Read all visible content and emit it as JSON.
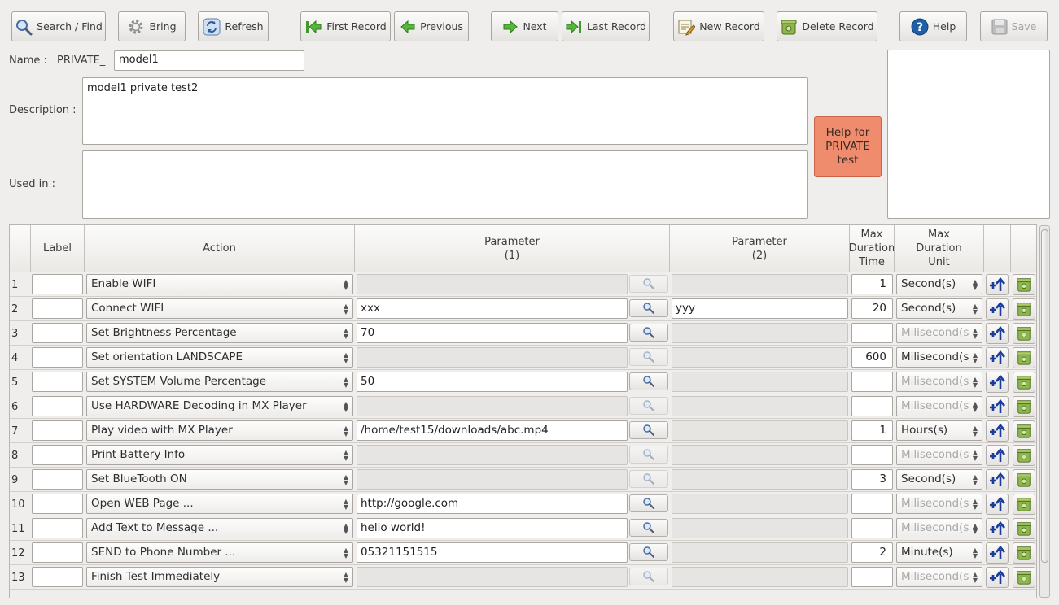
{
  "toolbar": {
    "search": "Search / Find",
    "bring": "Bring",
    "refresh": "Refresh",
    "first": "First Record",
    "previous": "Previous",
    "next": "Next",
    "last": "Last Record",
    "new": "New Record",
    "delete": "Delete Record",
    "help": "Help",
    "save": "Save"
  },
  "form": {
    "name_label": "Name :",
    "name_prefix": "PRIVATE_",
    "name_value": "model1",
    "description_label": "Description :",
    "description_value": "model1 private test2",
    "used_in_label": "Used in :",
    "used_in_value": "",
    "help_button": "Help for PRIVATE test"
  },
  "grid": {
    "headers": {
      "label": "Label",
      "action": "Action",
      "param1": "Parameter\n(1)",
      "param2": "Parameter\n(2)",
      "max_time": "Max\nDuration\nTime",
      "max_unit": "Max\nDuration\nUnit"
    },
    "rows": [
      {
        "n": "1",
        "label": "",
        "action": "Enable WIFI",
        "p1": "",
        "p1_enabled": false,
        "p2": "",
        "p2_enabled": false,
        "time": "1",
        "unit": "Second(s)",
        "unit_enabled": true
      },
      {
        "n": "2",
        "label": "",
        "action": "Connect WIFI",
        "p1": "xxx",
        "p1_enabled": true,
        "p2": "yyy",
        "p2_enabled": true,
        "time": "20",
        "unit": "Second(s)",
        "unit_enabled": true
      },
      {
        "n": "3",
        "label": "",
        "action": "Set Brightness Percentage",
        "p1": "70",
        "p1_enabled": true,
        "p2": "",
        "p2_enabled": false,
        "time": "",
        "unit": "Milisecond(s",
        "unit_enabled": false
      },
      {
        "n": "4",
        "label": "",
        "action": "Set orientation LANDSCAPE",
        "p1": "",
        "p1_enabled": false,
        "p2": "",
        "p2_enabled": false,
        "time": "600",
        "unit": "Milisecond(s",
        "unit_enabled": true
      },
      {
        "n": "5",
        "label": "",
        "action": "Set SYSTEM Volume Percentage",
        "p1": "50",
        "p1_enabled": true,
        "p2": "",
        "p2_enabled": false,
        "time": "",
        "unit": "Milisecond(s",
        "unit_enabled": false
      },
      {
        "n": "6",
        "label": "",
        "action": "Use HARDWARE Decoding in MX Player",
        "p1": "",
        "p1_enabled": false,
        "p2": "",
        "p2_enabled": false,
        "time": "",
        "unit": "Milisecond(s",
        "unit_enabled": false
      },
      {
        "n": "7",
        "label": "",
        "action": "Play video with MX Player",
        "p1": "/home/test15/downloads/abc.mp4",
        "p1_enabled": true,
        "p2": "",
        "p2_enabled": false,
        "time": "1",
        "unit": "Hours(s)",
        "unit_enabled": true
      },
      {
        "n": "8",
        "label": "",
        "action": "Print Battery Info",
        "p1": "",
        "p1_enabled": false,
        "p2": "",
        "p2_enabled": false,
        "time": "",
        "unit": "Milisecond(s",
        "unit_enabled": false
      },
      {
        "n": "9",
        "label": "",
        "action": "Set BlueTooth ON",
        "p1": "",
        "p1_enabled": false,
        "p2": "",
        "p2_enabled": false,
        "time": "3",
        "unit": "Second(s)",
        "unit_enabled": true
      },
      {
        "n": "10",
        "label": "",
        "action": "Open WEB Page ...",
        "p1": "http://google.com",
        "p1_enabled": true,
        "p2": "",
        "p2_enabled": false,
        "time": "",
        "unit": "Milisecond(s",
        "unit_enabled": false
      },
      {
        "n": "11",
        "label": "",
        "action": "Add Text to Message ...",
        "p1": "hello world!",
        "p1_enabled": true,
        "p2": "",
        "p2_enabled": false,
        "time": "",
        "unit": "Milisecond(s",
        "unit_enabled": false
      },
      {
        "n": "12",
        "label": "",
        "action": "SEND to Phone Number ...",
        "p1": "05321151515",
        "p1_enabled": true,
        "p2": "",
        "p2_enabled": false,
        "time": "2",
        "unit": "Minute(s)",
        "unit_enabled": true
      },
      {
        "n": "13",
        "label": "",
        "action": "Finish Test Immediately",
        "p1": "",
        "p1_enabled": false,
        "p2": "",
        "p2_enabled": false,
        "time": "",
        "unit": "Milisecond(s",
        "unit_enabled": false
      }
    ]
  },
  "colors": {
    "help_box": "#ef8c6d",
    "insert_arrow": "#1a3d9c",
    "bin_green": "#7ca53a"
  }
}
